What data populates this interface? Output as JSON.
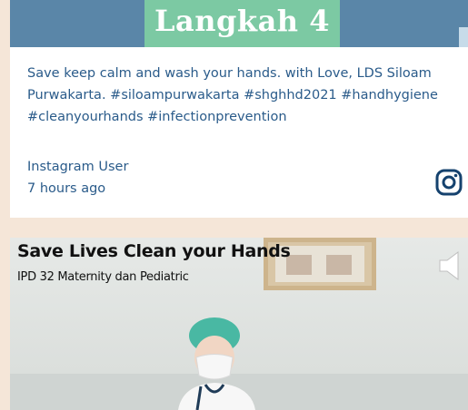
{
  "post1": {
    "banner_text": "Langkah 4",
    "caption": "Save keep calm and wash your hands. with Love, LDS Siloam Purwakarta. #siloampurwakarta #shghhd2021 #handhygiene #cleanyourhands #infectionprevention",
    "author": "Instagram User",
    "time": "7 hours ago",
    "platform_icon": "instagram-icon",
    "text_color": "#2a5b8a"
  },
  "post2": {
    "title": "Save Lives Clean your Hands",
    "subtitle": "IPD 32 Maternity dan Pediatric",
    "control_icon": "volume-icon"
  },
  "colors": {
    "page_background": "#f5e6d8",
    "banner": "#7cc9a3",
    "link_text": "#2a5b8a"
  }
}
